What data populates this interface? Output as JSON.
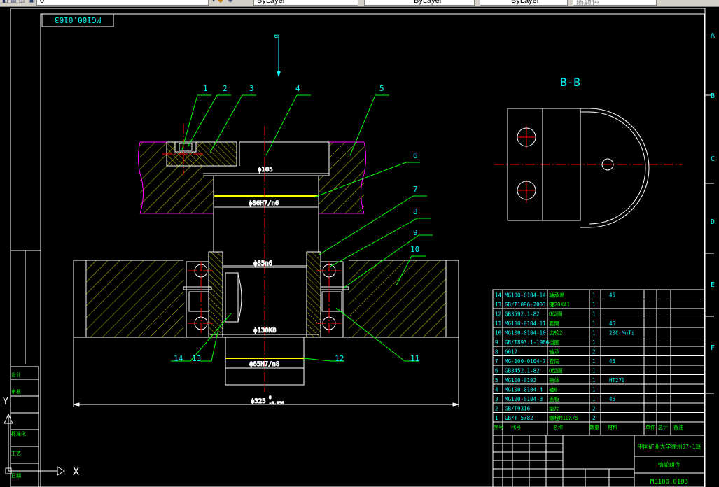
{
  "toolbar": {
    "layer_value": "0",
    "color_value": "ByLayer",
    "linetype_value": "ByLayer",
    "lineweight_value": "ByLayer",
    "plotstyle_value": "随颜色",
    "icons": [
      "layer-state-icon",
      "layer-props-icon",
      "make-current-icon",
      "layer-previous-icon"
    ]
  },
  "drawing": {
    "drawing_no_top": "MG100.0103",
    "section_label": "B-B",
    "section_mark": "B",
    "callouts": [
      "1",
      "2",
      "3",
      "4",
      "5",
      "6",
      "7",
      "8",
      "9",
      "10",
      "11",
      "12",
      "13",
      "14"
    ],
    "dims": {
      "d105": "ϕ105",
      "d86": "ϕ86H7/n6",
      "d85": "ϕ85n6",
      "d130": "ϕ130K8",
      "d65": "ϕ65H7/n8",
      "d325": "ϕ325",
      "d325_tol_up": "0",
      "d325_tol_low": "-0.036"
    },
    "border_rows": [
      "A",
      "B",
      "C",
      "D",
      "E",
      "F"
    ],
    "border_cols_left": [
      "设计",
      "审核",
      "标准化",
      "工艺",
      "日期"
    ]
  },
  "parts_table": {
    "rows": [
      {
        "no": "14",
        "code": "MG100-0104-14",
        "name": "轴承盖",
        "qty": "1",
        "material": "45"
      },
      {
        "no": "13",
        "code": "GB/T1096-2003",
        "name": "键20X41",
        "qty": "1",
        "material": ""
      },
      {
        "no": "12",
        "code": "GB3592.1-82",
        "name": "O型圈",
        "qty": "1",
        "material": ""
      },
      {
        "no": "11",
        "code": "MG100-0104-11",
        "name": "套筒",
        "qty": "1",
        "material": "45"
      },
      {
        "no": "10",
        "code": "MG100-0104-10",
        "name": "齿轮2",
        "qty": "1",
        "material": "20CrMnTi"
      },
      {
        "no": "9",
        "code": "GB/T893.1-1986",
        "name": "挡圈",
        "qty": "1",
        "material": ""
      },
      {
        "no": "8",
        "code": "6017",
        "name": "轴承",
        "qty": "2",
        "material": ""
      },
      {
        "no": "7",
        "code": "MG-100-0104-7",
        "name": "套筒",
        "qty": "1",
        "material": "45"
      },
      {
        "no": "6",
        "code": "GB3452.1-82",
        "name": "O型圈",
        "qty": "1",
        "material": ""
      },
      {
        "no": "5",
        "code": "MG100-0102",
        "name": "箱体",
        "qty": "1",
        "material": "HT270"
      },
      {
        "no": "4",
        "code": "MG100-0104-4",
        "name": "轴0",
        "qty": "1",
        "material": ""
      },
      {
        "no": "3",
        "code": "MG100-0104-3",
        "name": "盖板",
        "qty": "1",
        "material": "45"
      },
      {
        "no": "2",
        "code": "GB/T9316",
        "name": "垫片",
        "qty": "2",
        "material": ""
      },
      {
        "no": "1",
        "code": "GB/T 5782",
        "name": "螺栓M10X75",
        "qty": "2",
        "material": ""
      }
    ],
    "header": [
      "序号",
      "代号",
      "名称",
      "数量",
      "材料",
      "单件",
      "总计",
      "备注"
    ]
  },
  "title_block": {
    "company": "中国矿业大学徐州07-1班",
    "assembly_name": "惰轮组件",
    "drawing_no": "MG100.0103"
  },
  "ucs": {
    "x_label": "X",
    "y_label": "Y"
  },
  "colors": {
    "green": "#00ff00",
    "cyan": "#00ffff",
    "yellow": "#ffff00",
    "red": "#ff0000",
    "magenta": "#ff00ff",
    "white": "#ffffff",
    "black": "#000000"
  }
}
